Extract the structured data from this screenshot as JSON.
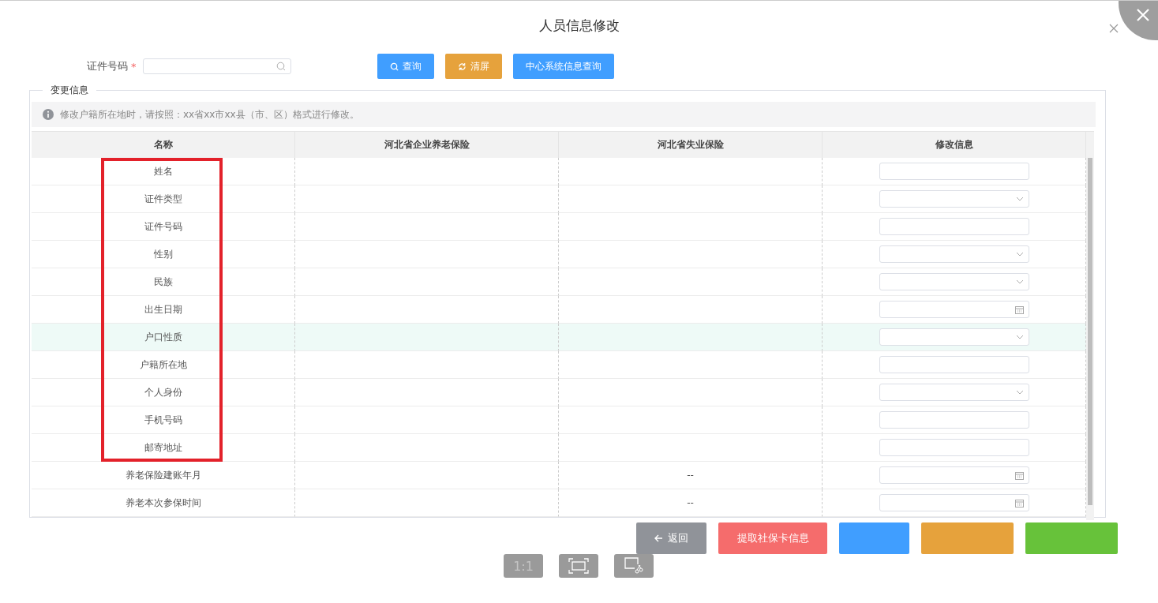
{
  "window": {
    "title": "人员信息修改"
  },
  "search": {
    "label": "证件号码",
    "required_mark": "*"
  },
  "actions": [
    {
      "label": "查询",
      "kind": "query"
    },
    {
      "label": "清屏",
      "kind": "clear"
    },
    {
      "label": "中心系统信息查询",
      "kind": "lookup"
    }
  ],
  "section": {
    "title": "变更信息",
    "notice": "修改户籍所在地时，请按照：xx省xx市xx县（市、区）格式进行修改。"
  },
  "table": {
    "columns": [
      "名称",
      "河北省企业养老保险",
      "河北省失业保险",
      "修改信息"
    ],
    "rows": [
      {
        "name": "姓名",
        "unemployment": "",
        "kind": "text",
        "highlighted": false,
        "annotated": true
      },
      {
        "name": "证件类型",
        "unemployment": "",
        "kind": "select",
        "highlighted": false,
        "annotated": true
      },
      {
        "name": "证件号码",
        "unemployment": "",
        "kind": "text",
        "highlighted": false,
        "annotated": true
      },
      {
        "name": "性别",
        "unemployment": "",
        "kind": "select",
        "highlighted": false,
        "annotated": true
      },
      {
        "name": "民族",
        "unemployment": "",
        "kind": "select",
        "highlighted": false,
        "annotated": true
      },
      {
        "name": "出生日期",
        "unemployment": "",
        "kind": "date",
        "highlighted": false,
        "annotated": true
      },
      {
        "name": "户口性质",
        "unemployment": "",
        "kind": "select",
        "highlighted": true,
        "annotated": true
      },
      {
        "name": "户籍所在地",
        "unemployment": "",
        "kind": "text",
        "highlighted": false,
        "annotated": true
      },
      {
        "name": "个人身份",
        "unemployment": "",
        "kind": "select",
        "highlighted": false,
        "annotated": true
      },
      {
        "name": "手机号码",
        "unemployment": "",
        "kind": "text",
        "highlighted": false,
        "annotated": true
      },
      {
        "name": "邮寄地址",
        "unemployment": "",
        "kind": "text",
        "highlighted": false,
        "annotated": true
      },
      {
        "name": "养老保险建账年月",
        "unemployment": "--",
        "kind": "date",
        "highlighted": false,
        "annotated": false
      },
      {
        "name": "养老本次参保时间",
        "unemployment": "--",
        "kind": "date",
        "highlighted": false,
        "annotated": false
      }
    ]
  },
  "footer_buttons": [
    {
      "label": "返回",
      "kind": "back"
    },
    {
      "label": "提取社保卡信息",
      "kind": "danger"
    },
    {
      "kind": "primary"
    },
    {
      "kind": "warning"
    },
    {
      "kind": "success"
    }
  ],
  "viewer_toolbar": [
    {
      "label": "1:1",
      "kind": "actual-size",
      "disabled": true
    },
    {
      "kind": "fit",
      "disabled": false
    },
    {
      "kind": "capture",
      "disabled": false
    }
  ]
}
